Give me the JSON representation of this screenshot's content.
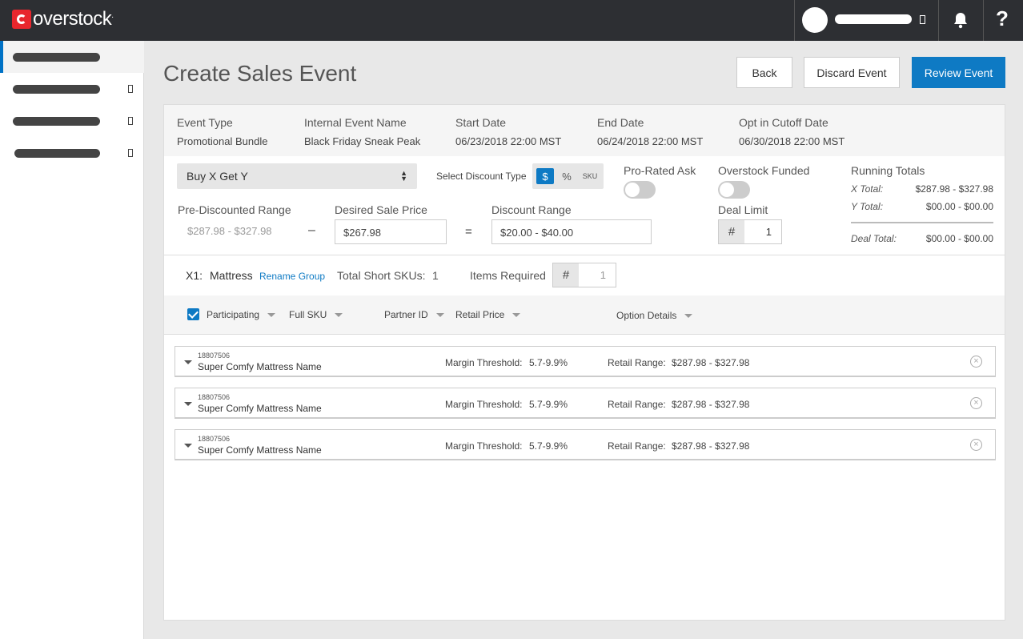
{
  "brand": {
    "logo_text": "overstock",
    "logo_suffix": "."
  },
  "header": {
    "title": "Create Sales Event",
    "help_label": "?",
    "buttons": {
      "back": "Back",
      "discard": "Discard Event",
      "review": "Review Event"
    },
    "accent": "#0e7ac4"
  },
  "event": {
    "type_label": "Event Type",
    "type_value": "Promotional Bundle",
    "name_label": "Internal Event Name",
    "name_value": "Black Friday Sneak Peak",
    "start_label": "Start Date",
    "start_value": "06/23/2018 22:00 MST",
    "end_label": "End Date",
    "end_value": "06/24/2018 22:00 MST",
    "cutoff_label": "Opt in Cutoff Date",
    "cutoff_value": "06/30/2018 22:00 MST"
  },
  "config": {
    "deal_type": "Buy X Get Y",
    "discount_type_label": "Select Discount Type",
    "discount_options": [
      "$",
      "%",
      "SKU"
    ],
    "selected_discount": "$",
    "pro_rated_label": "Pro-Rated Ask",
    "overstock_funded_label": "Overstock Funded",
    "pre_discounted_label": "Pre-Discounted Range",
    "pre_discounted_value": "$287.98 - $327.98",
    "minus": "–",
    "desired_label": "Desired Sale Price",
    "desired_value": "$267.98",
    "equals": "=",
    "discount_range_label": "Discount Range",
    "discount_range_value": "$20.00 - $40.00",
    "deal_limit_label": "Deal Limit",
    "deal_limit_hash": "#",
    "deal_limit_value": "1"
  },
  "totals": {
    "title": "Running Totals",
    "x_label": "X Total:",
    "x_value": "$287.98 - $327.98",
    "y_label": "Y Total:",
    "y_value": "$00.00 - $00.00",
    "deal_label": "Deal Total:",
    "deal_value": "$00.00 - $00.00"
  },
  "group": {
    "prefix": "X1:",
    "name": "Mattress",
    "rename_label": "Rename Group",
    "short_skus_label": "Total Short SKUs:",
    "short_skus_value": "1",
    "items_required_label": "Items Required",
    "items_hash": "#",
    "items_value": "1"
  },
  "columns": [
    "Participating",
    "Full SKU",
    "Partner ID",
    "Retail Price",
    "Option Details"
  ],
  "rows": [
    {
      "sku": "18807506",
      "name": "Super Comfy Mattress Name",
      "margin_label": "Margin Threshold:",
      "margin_value": "5.7-9.9%",
      "retail_label": "Retail Range:",
      "retail_value": "$287.98 - $327.98"
    },
    {
      "sku": "18807506",
      "name": "Super Comfy Mattress Name",
      "margin_label": "Margin Threshold:",
      "margin_value": "5.7-9.9%",
      "retail_label": "Retail Range:",
      "retail_value": "$287.98 - $327.98"
    },
    {
      "sku": "18807506",
      "name": "Super Comfy Mattress Name",
      "margin_label": "Margin Threshold:",
      "margin_value": "5.7-9.9%",
      "retail_label": "Retail Range:",
      "retail_value": "$287.98 - $327.98"
    }
  ],
  "icons": {
    "close": "×",
    "select_arrows": "▲▼"
  }
}
